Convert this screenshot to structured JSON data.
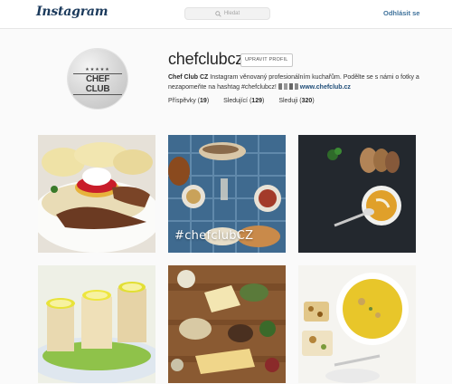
{
  "nav": {
    "logo": "Instagram",
    "search_placeholder": "Hledat",
    "logout": "Odhlásit se"
  },
  "profile": {
    "avatar_stars": "★★★★★",
    "avatar_text": "CHEF CLUB",
    "username": "chefclubcz",
    "edit_button": "UPRAVIT PROFIL",
    "bio_name": "Chef Club CZ",
    "bio_text": " Instagram věnovaný profesionálním kuchařům. Podělte se s námi o fotky a nezapomeňte na hashtag #chefclubcz! ",
    "bio_link": "www.chefclub.cz",
    "stats": {
      "posts_label": "Příspěvky",
      "posts_value": "19",
      "followers_label": "Sledující",
      "followers_value": "129",
      "following_label": "Sleduji",
      "following_value": "320"
    }
  },
  "posts": [
    {
      "description": "svickova-dish"
    },
    {
      "description": "table-feast",
      "overlay": "#chefclubCZ"
    },
    {
      "description": "soup-with-bread"
    },
    {
      "description": "lemon-terrines"
    },
    {
      "description": "cheese-board"
    },
    {
      "description": "yellow-soup-bowl"
    }
  ]
}
